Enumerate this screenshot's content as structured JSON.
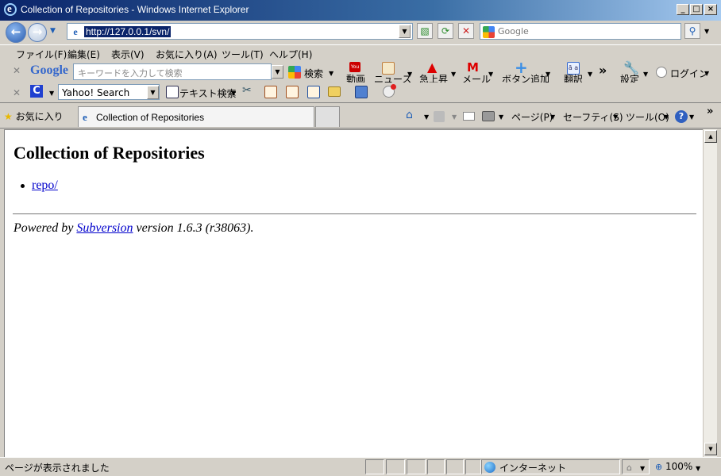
{
  "window": {
    "title": "Collection of Repositories - Windows Internet Explorer"
  },
  "address": {
    "url": "http://127.0.0.1/svn/"
  },
  "search": {
    "placeholder": "Google"
  },
  "menu": [
    "ファイル(F)",
    "編集(E)",
    "表示(V)",
    "お気に入り(A)",
    "ツール(T)",
    "ヘルプ(H)"
  ],
  "google_toolbar": {
    "logo": "Google",
    "input_placeholder": "キーワードを入力して検索",
    "search_label": "検索",
    "video": "動画",
    "news": "ニュース",
    "trending": "急上昇",
    "mail": "メール",
    "add_button": "ボタン追加",
    "translate": "翻訳",
    "settings": "設定",
    "login": "ログイン",
    "more": "»"
  },
  "second_toolbar": {
    "engine_value": "Yahoo! Search",
    "text_search": "テキスト検索"
  },
  "tabs": {
    "favorites": "お気に入り",
    "active_tab": "Collection of Repositories",
    "page": "ページ(P)",
    "safety": "セーフティ(S)",
    "tools": "ツール(O)",
    "more": "»"
  },
  "page": {
    "heading": "Collection of Repositories",
    "items": [
      {
        "label": "repo/"
      }
    ],
    "footer_prefix": "Powered by",
    "footer_link": "Subversion",
    "footer_suffix": "version 1.6.3 (r38063)."
  },
  "status": {
    "text": "ページが表示されました",
    "zone": "インターネット",
    "zoom": "100%"
  },
  "colors": {
    "title_bar": "#0a246a",
    "link": "#0000cc",
    "address_highlight": "#0a246a"
  }
}
